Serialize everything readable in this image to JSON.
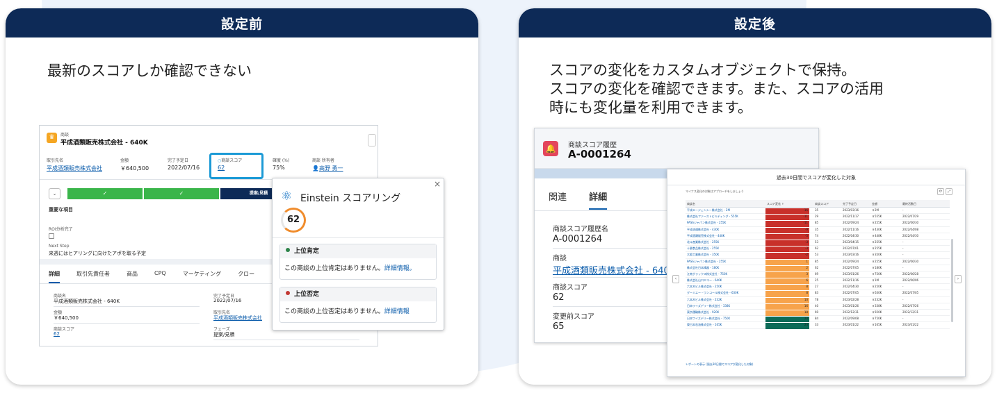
{
  "left": {
    "header": "設定前",
    "description": "最新のスコアしか確認できない",
    "shot": {
      "record_type": "商談",
      "record_name": "平成酒類販売株式会社 - 640K",
      "fields": [
        {
          "label": "取引先名",
          "value": "平成酒類販売株式会社",
          "link": true
        },
        {
          "label": "金額",
          "value": "￥640,500",
          "link": false
        },
        {
          "label": "完了予定日",
          "value": "2022/07/16",
          "link": false
        },
        {
          "label": "商談スコア",
          "value": "62",
          "link": true
        },
        {
          "label": "確度 (%)",
          "value": "75%",
          "link": false
        },
        {
          "label": "商談 所有者",
          "value": "高野 勇一",
          "link": true
        }
      ],
      "path_current": "提案/見積",
      "key_title": "重要な項目",
      "key_roi_label": "ROI分析完了",
      "key_next_label": "Next Step",
      "key_next_value": "来週にはヒアリングに向けたアポを取る予定",
      "tabs": [
        "詳細",
        "取引先責任者",
        "商品",
        "CPQ",
        "マーケティング",
        "クロー"
      ],
      "details": [
        {
          "label": "商談名",
          "value": "平成酒類販売株式会社 - 640K"
        },
        {
          "label": "完了予定日",
          "value": "2022/07/16"
        },
        {
          "label": "金額",
          "value": "￥640,500"
        },
        {
          "label": "取引先名",
          "value": "平成酒類販売株式会社"
        },
        {
          "label": "商談スコア",
          "value": "62"
        },
        {
          "label": "フェーズ",
          "value": "提案/見積"
        }
      ]
    },
    "popup": {
      "title": "Einstein スコアリング",
      "score": "62",
      "pos_title": "上位肯定",
      "pos_text": "この商談の上位肯定はありません。",
      "pos_link": "詳細情報。",
      "neg_title": "上位否定",
      "neg_text": "この商談の上位否定はありません。",
      "neg_link": "詳細情報"
    }
  },
  "right": {
    "header": "設定後",
    "description": [
      "スコアの変化をカスタムオブジェクトで保持。",
      "スコアの変化を確認できます。また、スコアの活用",
      "時にも変化量を利用できます。"
    ],
    "record": {
      "type": "商談スコア履歴",
      "name": "A-0001264",
      "tabs": [
        "関連",
        "詳細"
      ],
      "fields": [
        {
          "label": "商談スコア履歴名",
          "value": "A-0001264",
          "link": false
        },
        {
          "label": "商談",
          "value": "平成酒類販売株式会社 - 640K",
          "link": true
        },
        {
          "label": "商談スコア",
          "value": "62",
          "link": false
        },
        {
          "label": "変更前スコア",
          "value": "65",
          "link": false
        }
      ]
    },
    "report": {
      "title": "過去30日間でスコアが変化した対象",
      "note": "マイナス変化の対象はアプローチをしましょう",
      "columns": [
        "商談名",
        "スコア変化 ↑",
        "商談スコア",
        "完了予定日",
        "金額",
        "最終活動日"
      ],
      "footer": "レポートの表示 (過去30日間でスコアが変化した対象)",
      "rows": [
        {
          "name": "平成エージェンシー株式会社 - 2M",
          "change": "-16",
          "score": "35",
          "date": "2023/03/16",
          "amount": "￥2M",
          "last": "-",
          "color": "#c8302a"
        },
        {
          "name": "株式会社ファーストビルディング - 555K",
          "change": "-11",
          "score": "29",
          "date": "2022/11/17",
          "amount": "￥555K",
          "last": "2022/07/29",
          "color": "#c8302a"
        },
        {
          "name": "PASSジャパン株式会社 - 255K",
          "change": "-11",
          "score": "85",
          "date": "2022/09/24",
          "amount": "￥255K",
          "last": "2022/06/30",
          "color": "#c8302a"
        },
        {
          "name": "平成流通株式会社 - 430K",
          "change": "-9",
          "score": "35",
          "date": "2022/11/16",
          "amount": "￥430K",
          "last": "2022/04/08",
          "color": "#c8302a"
        },
        {
          "name": "平成酒類販売株式会社 - 448K",
          "change": "-5",
          "score": "74",
          "date": "2022/04/30",
          "amount": "￥448K",
          "last": "2022/04/30",
          "color": "#c8302a"
        },
        {
          "name": "北斗産業株式会社 - 255K",
          "change": "-3",
          "score": "53",
          "date": "2023/04/15",
          "amount": "￥255K",
          "last": "-",
          "color": "#c8302a"
        },
        {
          "name": "十勝食品株式会社 - 255K",
          "change": "-3",
          "score": "62",
          "date": "2022/07/01",
          "amount": "￥255K",
          "last": "-",
          "color": "#c8302a"
        },
        {
          "name": "大阪工業株式会社 - 350K",
          "change": "-2",
          "score": "53",
          "date": "2023/03/16",
          "amount": "￥350K",
          "last": "-",
          "color": "#c8302a"
        },
        {
          "name": "PASSジャパン株式会社 - 255K",
          "change": "1",
          "score": "85",
          "date": "2022/09/24",
          "amount": "￥255K",
          "last": "2022/06/30",
          "color": "#f7a34b"
        },
        {
          "name": "株式会社日本精器 - 180K",
          "change": "2",
          "score": "62",
          "date": "2022/07/05",
          "amount": "￥180K",
          "last": "-",
          "color": "#f7a34b"
        },
        {
          "name": "江南グラックス株式会社 - 750K",
          "change": "3",
          "score": "69",
          "date": "2023/01/26",
          "amount": "￥750K",
          "last": "2022/06/28",
          "color": "#f7a34b"
        },
        {
          "name": "株式会社山口エコー - 640K",
          "change": "6",
          "score": "25",
          "date": "2022/11/16",
          "amount": "￥1M",
          "last": "2022/06/06",
          "color": "#f7a34b"
        },
        {
          "name": "六本木ビル株式会社 - 250K",
          "change": "8",
          "score": "27",
          "date": "2022/04/30",
          "amount": "￥250K",
          "last": "-",
          "color": "#f7a34b"
        },
        {
          "name": "グーミエー・ワンコール株式会社 - 630K",
          "change": "8",
          "score": "83",
          "date": "2022/07/05",
          "amount": "￥630K",
          "last": "2022/07/05",
          "color": "#f7a34b"
        },
        {
          "name": "六本木ビル株式会社 - 232K",
          "change": "10",
          "score": "78",
          "date": "2023/02/28",
          "amount": "￥232K",
          "last": "-",
          "color": "#f7a34b"
        },
        {
          "name": "日本ワイズデリー株式会社 - 338K",
          "change": "16",
          "score": "40",
          "date": "2023/01/26",
          "amount": "￥338K",
          "last": "2022/07/26",
          "color": "#f7a34b"
        },
        {
          "name": "東京運輸株式会社 - 920K",
          "change": "18",
          "score": "69",
          "date": "2022/12/31",
          "amount": "￥920K",
          "last": "2022/12/31",
          "color": "#f7a34b"
        },
        {
          "name": "日本ワイズデリー株式会社 - 750K",
          "change": "20",
          "score": "84",
          "date": "2022/09/08",
          "amount": "￥750K",
          "last": "-",
          "color": "#0c6b58"
        },
        {
          "name": "東日本石油株式会社 - 165K",
          "change": "23",
          "score": "33",
          "date": "2023/01/22",
          "amount": "￥165K",
          "last": "2023/01/22",
          "color": "#0c6b58"
        }
      ]
    }
  }
}
